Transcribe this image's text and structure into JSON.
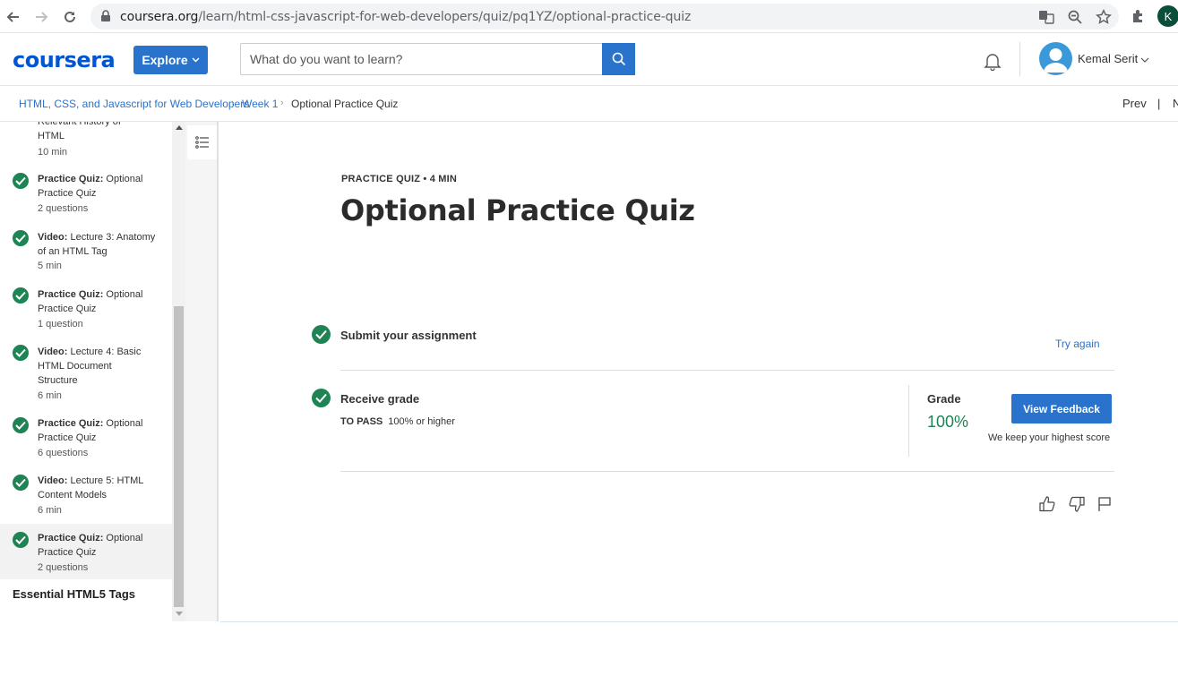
{
  "browser": {
    "url_host": "coursera.org",
    "url_path": "/learn/html-css-javascript-for-web-developers/quiz/pq1YZ/optional-practice-quiz",
    "profile_initial": "K",
    "icons": [
      "back-icon",
      "forward-icon",
      "reload-icon",
      "lock-icon",
      "translate-icon",
      "zoom-icon",
      "star-icon",
      "extensions-icon"
    ]
  },
  "header": {
    "logo": "coursera",
    "explore_label": "Explore",
    "search_placeholder": "What do you want to learn?",
    "username": "Kemal Serit"
  },
  "breadcrumb": {
    "course": "HTML, CSS, and Javascript for Web Developers",
    "week": "Week 1",
    "current": "Optional Practice Quiz",
    "prev": "Prev",
    "pipe": "|",
    "next": "N"
  },
  "sidebar": {
    "partial_item": {
      "title": "Relevant History of HTML",
      "sub": "10 min"
    },
    "items": [
      {
        "type": "Practice Quiz:",
        "title": "Optional Practice Quiz",
        "sub": "2 questions"
      },
      {
        "type": "Video:",
        "title": "Lecture 3: Anatomy of an HTML Tag",
        "sub": "5 min"
      },
      {
        "type": "Practice Quiz:",
        "title": "Optional Practice Quiz",
        "sub": "1 question"
      },
      {
        "type": "Video:",
        "title": "Lecture 4: Basic HTML Document Structure",
        "sub": "6 min"
      },
      {
        "type": "Practice Quiz:",
        "title": "Optional Practice Quiz",
        "sub": "6 questions"
      },
      {
        "type": "Video:",
        "title": "Lecture 5: HTML Content Models",
        "sub": "6 min"
      },
      {
        "type": "Practice Quiz:",
        "title": "Optional Practice Quiz",
        "sub": "2 questions"
      }
    ],
    "section_heading": "Essential HTML5 Tags"
  },
  "main": {
    "kicker": "PRACTICE QUIZ • 4 MIN",
    "title": "Optional Practice Quiz",
    "step1": {
      "title": "Submit your assignment",
      "action": "Try again"
    },
    "step2": {
      "title": "Receive grade",
      "to_pass_label": "TO PASS",
      "to_pass_value": "100% or higher"
    },
    "grade": {
      "label": "Grade",
      "value": "100%",
      "button": "View Feedback",
      "note": "We keep your highest score"
    }
  },
  "colors": {
    "brand": "#0056d2",
    "accent": "#2a73cc",
    "success": "#1f8354"
  }
}
